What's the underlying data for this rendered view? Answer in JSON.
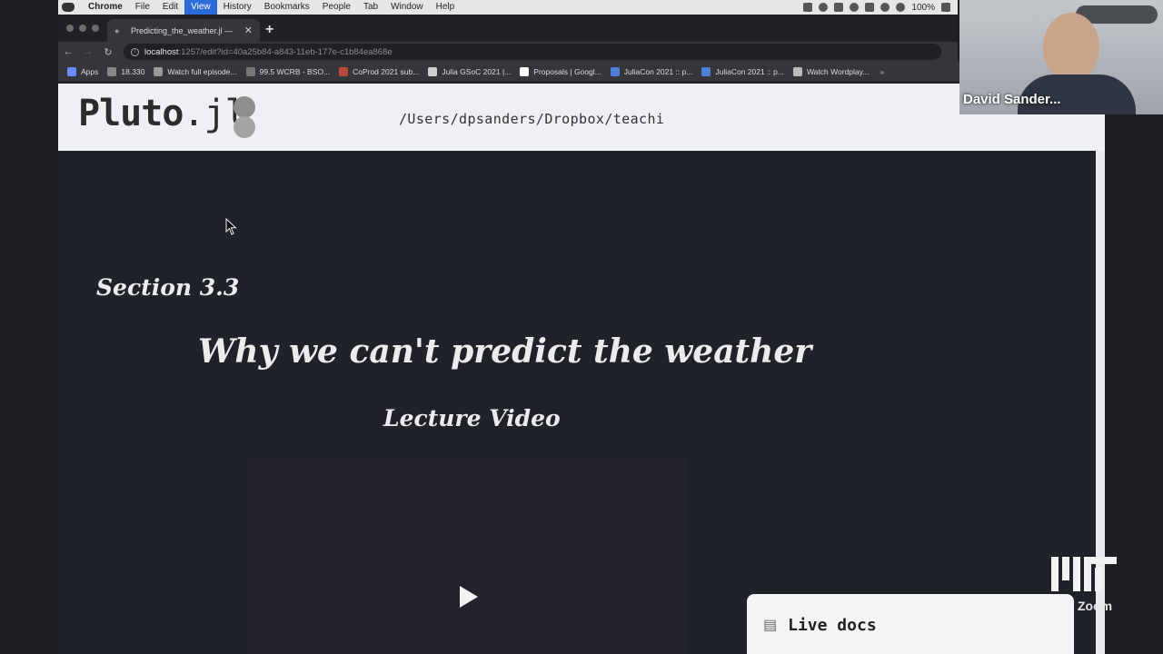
{
  "menubar": {
    "app": "Chrome",
    "items": [
      "File",
      "Edit",
      "View",
      "History",
      "Bookmarks",
      "People",
      "Tab",
      "Window",
      "Help"
    ],
    "active": "View",
    "battery": "100%"
  },
  "tab": {
    "title": "Predicting_the_weather.jl —"
  },
  "omnibox": {
    "host": "localhost",
    "rest": ":1257/edit?id=40a25b84-a843-11eb-177e-c1b84ea868e"
  },
  "bookmarks": [
    {
      "label": "Apps",
      "color": "#6b8cff"
    },
    {
      "label": "18.330",
      "color": "#888888"
    },
    {
      "label": "Watch full episode...",
      "color": "#999999"
    },
    {
      "label": "99.5 WCRB - BSO...",
      "color": "#777777"
    },
    {
      "label": "CoProd 2021 sub...",
      "color": "#b94a3a"
    },
    {
      "label": "Julia GSoC 2021 |...",
      "color": "#d0d0d0"
    },
    {
      "label": "Proposals | Googl...",
      "color": "#ffffff"
    },
    {
      "label": "JuliaCon 2021 :: p...",
      "color": "#4e7fd6"
    },
    {
      "label": "JuliaCon 2021 :: p...",
      "color": "#4e7fd6"
    },
    {
      "label": "Watch Wordplay...",
      "color": "#bbbbbb"
    }
  ],
  "bookmarks_more": "»",
  "pluto": {
    "logo_main": "Pluto",
    "logo_ext": ".jl",
    "path": "/Users/dpsanders/Dropbox/teachi"
  },
  "notebook": {
    "section": "Section 3.3",
    "title": "Why we can't predict the weather",
    "video_heading": "Lecture Video"
  },
  "live_docs": {
    "icon": "books-icon",
    "label": "Live docs"
  },
  "webcam": {
    "name": "David Sander..."
  },
  "overlay": {
    "zoom_label": "Zoom"
  }
}
